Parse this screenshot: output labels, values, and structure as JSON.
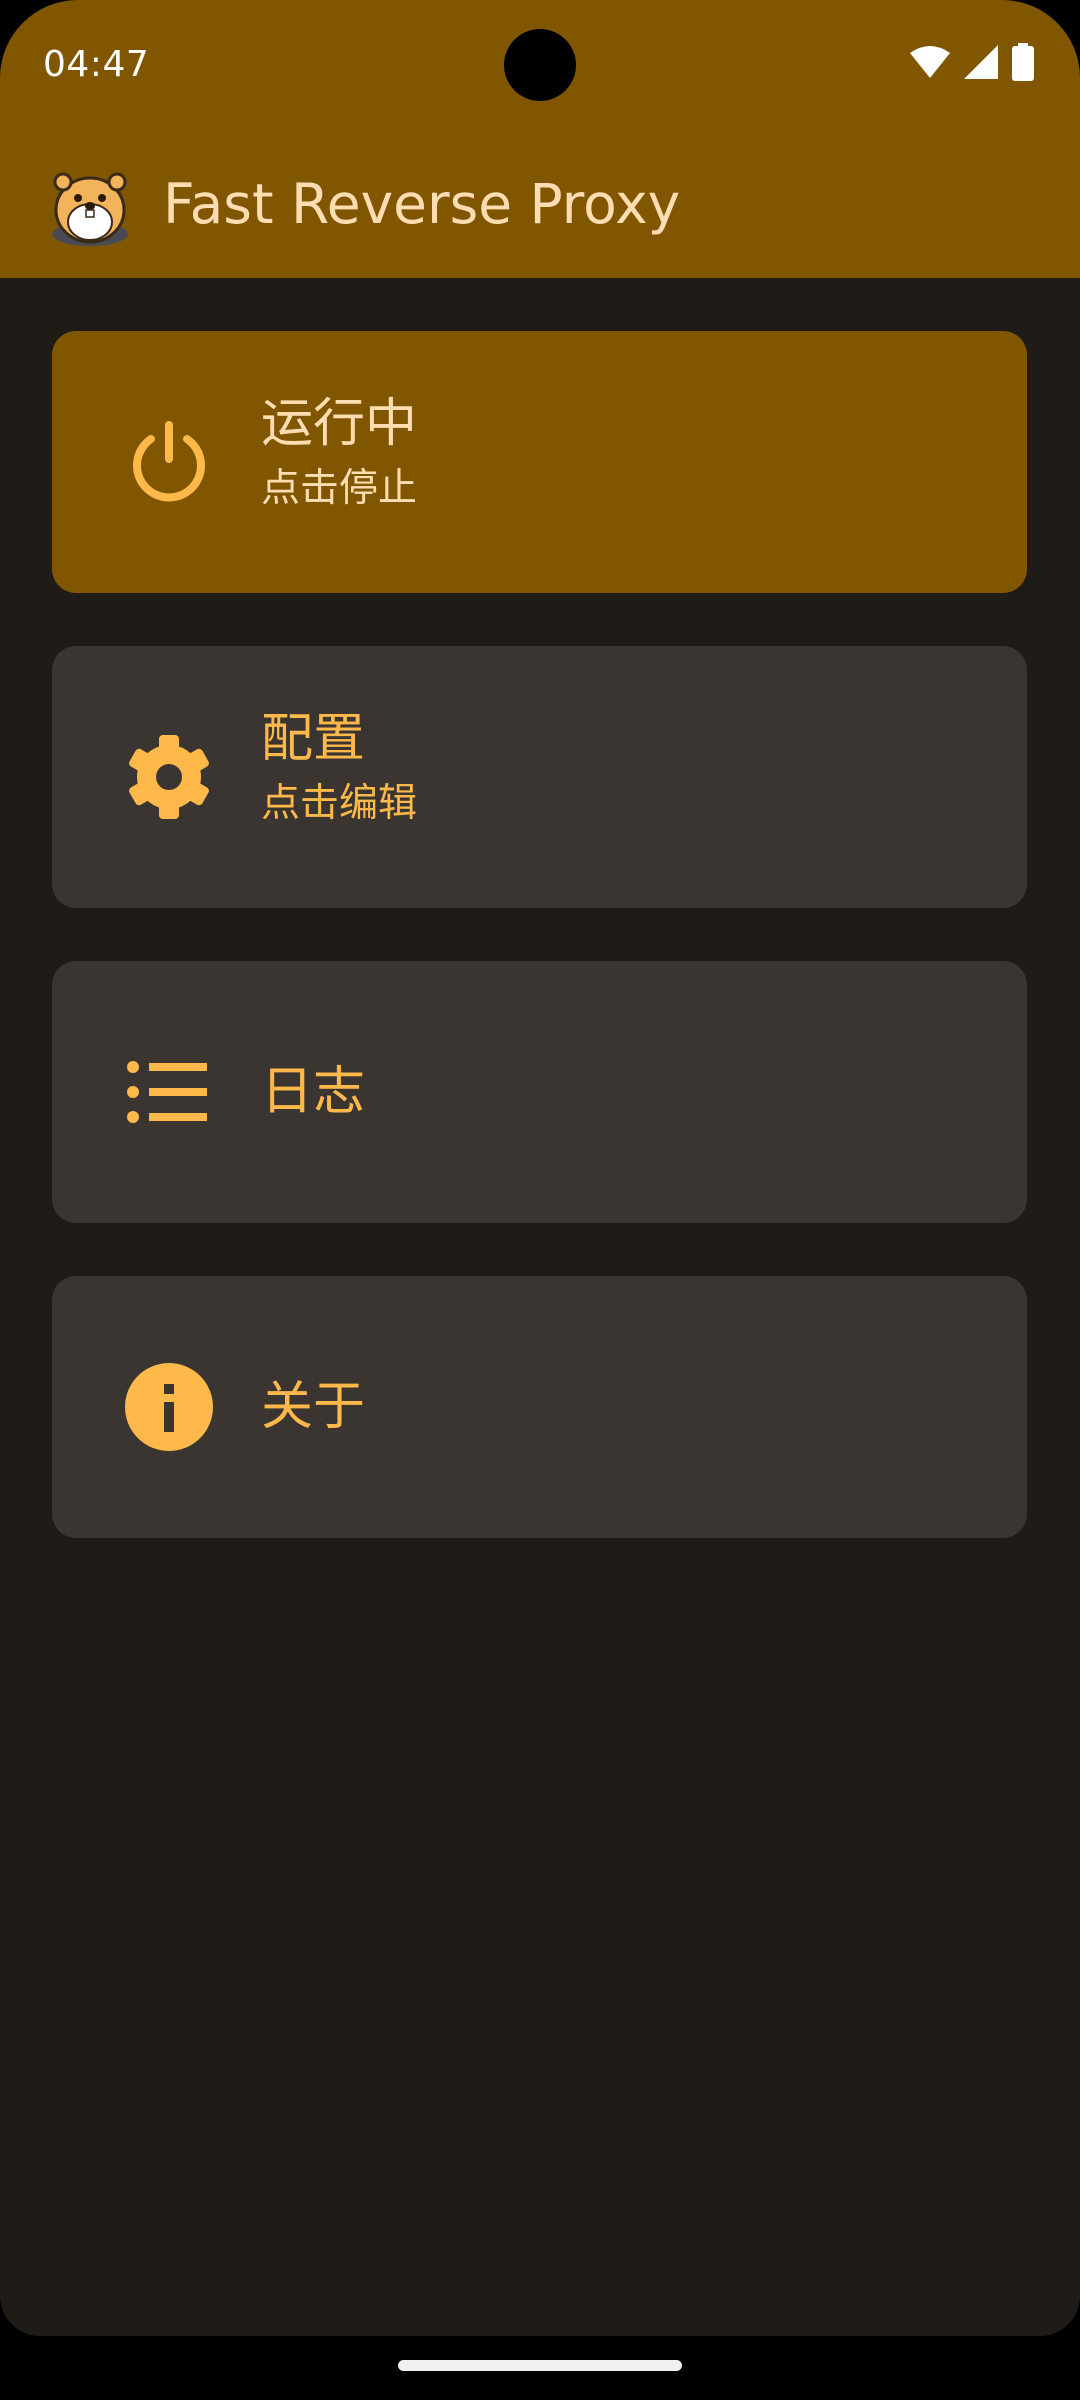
{
  "status_bar": {
    "time": "04:47",
    "icons": [
      "wifi-icon",
      "signal-icon",
      "battery-icon"
    ]
  },
  "app_bar": {
    "title": "Fast Reverse Proxy",
    "logo_icon": "gopher-mascot-icon"
  },
  "cards": {
    "status": {
      "title": "运行中",
      "subtitle": "点击停止",
      "icon": "power-icon",
      "state": "running"
    },
    "config": {
      "title": "配置",
      "subtitle": "点击编辑",
      "icon": "gear-icon"
    },
    "logs": {
      "title": "日志",
      "icon": "list-icon"
    },
    "about": {
      "title": "关于",
      "icon": "info-icon"
    }
  },
  "colors": {
    "primary_container": "#815600",
    "on_primary_container": "#FFDDB3",
    "accent": "#FFB94A",
    "surface": "#1F1B17",
    "card_surface": "#3A3531"
  }
}
